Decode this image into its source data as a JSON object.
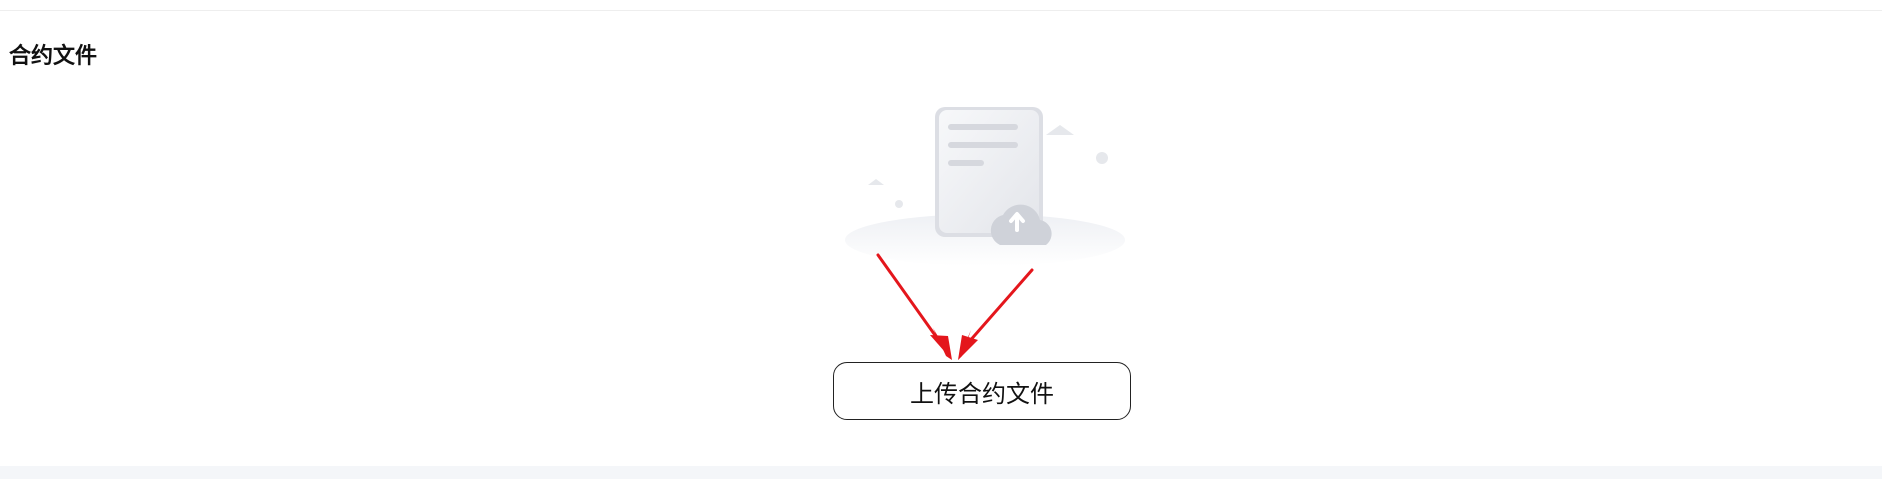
{
  "section": {
    "title": "合约文件"
  },
  "empty_state": {
    "illustration_icon": "document-upload-cloud-icon",
    "annotation_icon": "red-arrows-icon"
  },
  "upload": {
    "button_label": "上传合约文件"
  },
  "colors": {
    "arrow_red": "#e4161c",
    "illustration_gray": "#d9dbe0",
    "button_border": "#222222",
    "bottom_band": "#f4f6f9"
  }
}
